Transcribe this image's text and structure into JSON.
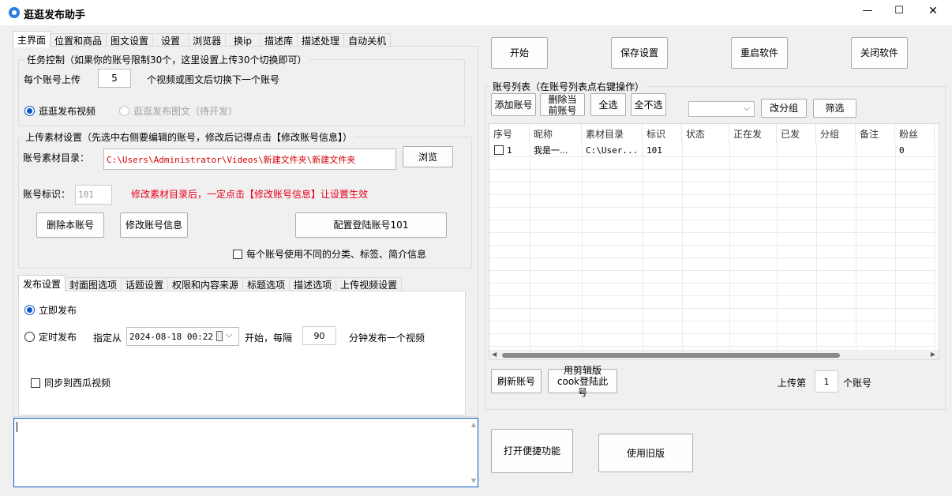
{
  "window": {
    "title": "逛逛发布助手",
    "minimize": "—",
    "maximize": "☐",
    "close": "✕"
  },
  "main_tabs": [
    "主界面",
    "位置和商品",
    "图文设置",
    "设置",
    "浏览器",
    "换ip",
    "描述库",
    "描述处理",
    "自动关机"
  ],
  "task": {
    "title": "任务控制（如果你的账号限制30个，这里设置上传30个切换即可）",
    "per_account_label": "每个账号上传",
    "per_account_value": "5",
    "per_account_suffix": "个视频或图文后切换下一个账号",
    "radio_video": "逛逛发布视频",
    "radio_image": "逛逛发布图文（待开发）"
  },
  "upload": {
    "title": "上传素材设置（先选中右侧要编辑的账号，修改后记得点击【修改账号信息】）",
    "dir_label": "账号素材目录：",
    "dir_value": "C:\\Users\\Administrator\\Videos\\新建文件夹\\新建文件夹",
    "browse": "浏览",
    "id_label": "账号标识：",
    "id_value": "101",
    "warning": "修改素材目录后，一定点击【修改账号信息】让设置生效",
    "delete_btn": "删除本账号",
    "modify_btn": "修改账号信息",
    "config_btn": "配置登陆账号101",
    "diff_checkbox": "每个账号使用不同的分类、标签、简介信息"
  },
  "sub_tabs": [
    "发布设置",
    "封面图选项",
    "话题设置",
    "权限和内容来源",
    "标题选项",
    "描述选项",
    "上传视频设置"
  ],
  "publish": {
    "now": "立即发布",
    "scheduled": "定时发布",
    "from_label": "指定从",
    "datetime": "2024-08-18 00:22",
    "start_each": "开始，每隔",
    "interval": "90",
    "interval_suffix": "分钟发布一个视频",
    "sync": "同步到西瓜视频"
  },
  "top_buttons": {
    "start": "开始",
    "save": "保存设置",
    "restart": "重启软件",
    "close": "关闭软件"
  },
  "accounts": {
    "title": "账号列表（在账号列表点右键操作）",
    "add": "添加账号",
    "delete_current": "删除当前账号",
    "select_all": "全选",
    "select_none": "全不选",
    "group_select": "",
    "change_group": "改分组",
    "filter": "筛选",
    "columns": [
      "序号",
      "昵称",
      "素材目录",
      "标识",
      "状态",
      "正在发",
      "已发",
      "分组",
      "备注",
      "粉丝"
    ],
    "rows": [
      {
        "index": "1",
        "nickname": "我是一...",
        "dir": "C:\\User...",
        "id": "101",
        "status": "",
        "sending": "",
        "sent": "",
        "group": "",
        "note": "",
        "fans": "0"
      }
    ],
    "refresh": "刷新账号",
    "cookie_login": "用剪辑版cook登陆此号",
    "upload_nth_label": "上传第",
    "upload_nth_value": "1",
    "upload_nth_suffix": "个账号"
  },
  "bottom_buttons": {
    "shortcut": "打开便捷功能",
    "old_version": "使用旧版"
  },
  "colors": {
    "accent": "#0a59c6",
    "warning": "#e8001c",
    "path_text": "#d40000"
  }
}
